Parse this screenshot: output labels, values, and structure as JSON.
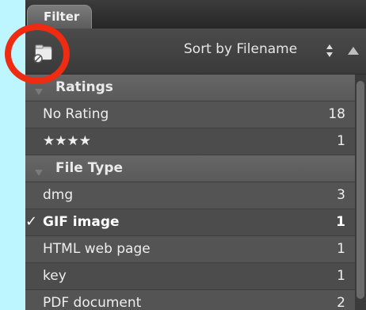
{
  "tab": {
    "label": "Filter"
  },
  "toolbar": {
    "folder_icon": "folder-icon",
    "sort_label": "Sort by Filename",
    "sort_arrows_icon": "up-down-arrows-icon",
    "up_icon": "triangle-up-icon"
  },
  "groups": [
    {
      "header": "Ratings",
      "rows": [
        {
          "label": "No Rating",
          "count": "18",
          "checked": false
        },
        {
          "label": "★★★★",
          "count": "1",
          "checked": false
        }
      ]
    },
    {
      "header": "File Type",
      "rows": [
        {
          "label": "dmg",
          "count": "3",
          "checked": false
        },
        {
          "label": "GIF image",
          "count": "1",
          "checked": true
        },
        {
          "label": "HTML web page",
          "count": "1",
          "checked": false
        },
        {
          "label": "key",
          "count": "1",
          "checked": false
        },
        {
          "label": "PDF document",
          "count": "2",
          "checked": false
        }
      ]
    }
  ],
  "check_glyph": "✓",
  "colors": {
    "background": "#bdf6ff",
    "panel": "#505050",
    "highlight_ring": "#ef2b12"
  }
}
